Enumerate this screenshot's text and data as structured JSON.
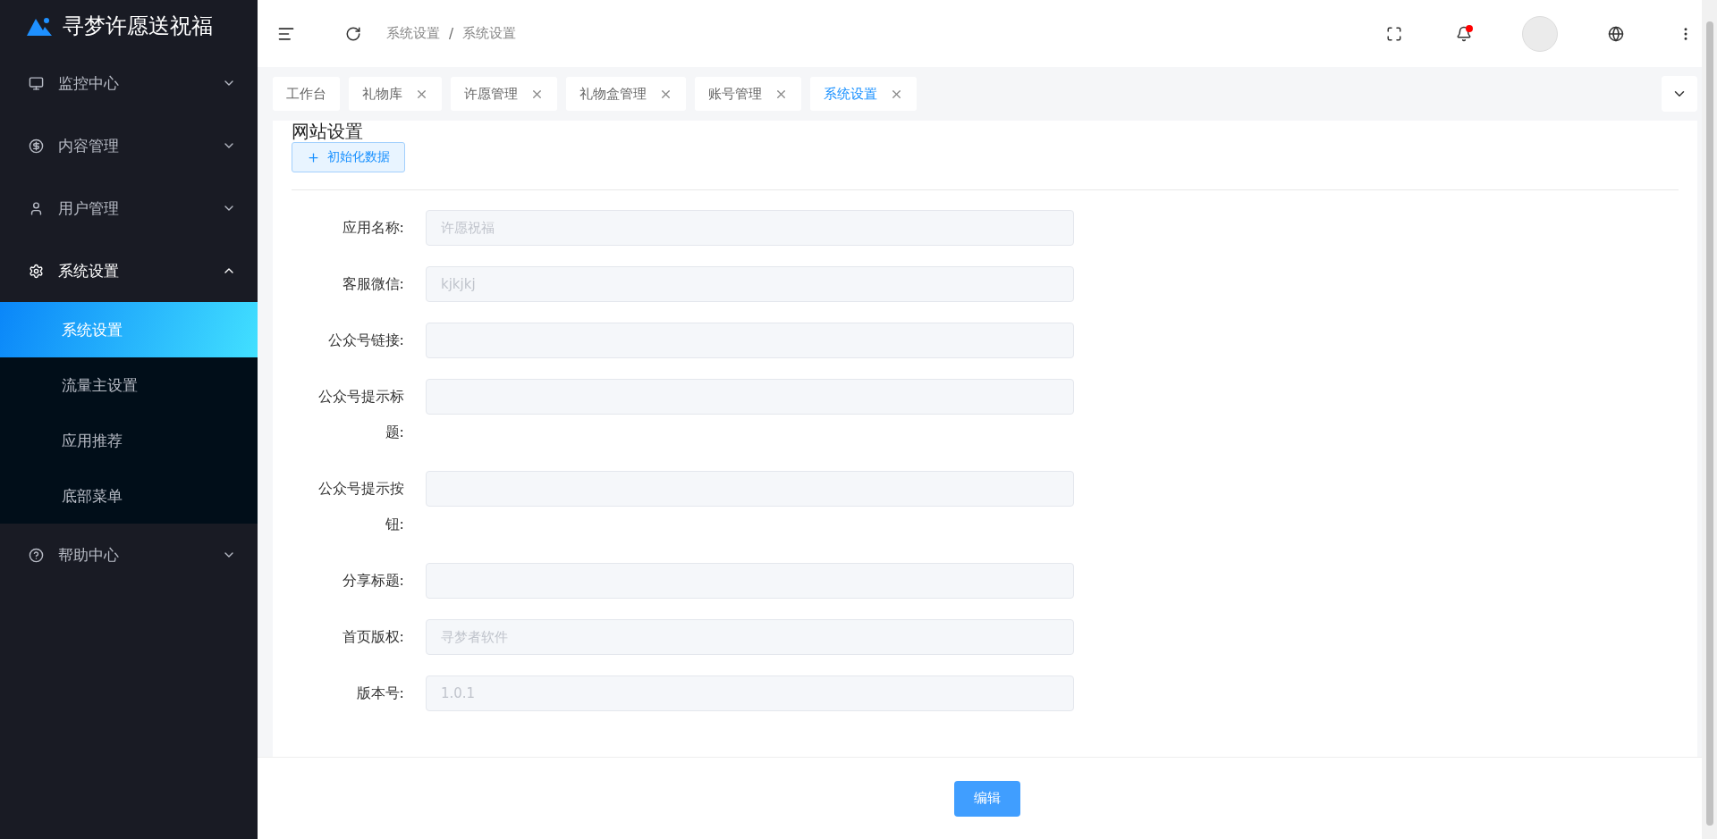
{
  "app": {
    "title": "寻梦许愿送祝福"
  },
  "sidebar": {
    "items": [
      {
        "label": "监控中心",
        "expanded": false
      },
      {
        "label": "内容管理",
        "expanded": false
      },
      {
        "label": "用户管理",
        "expanded": false
      },
      {
        "label": "系统设置",
        "expanded": true,
        "children": [
          {
            "label": "系统设置",
            "selected": true
          },
          {
            "label": "流量主设置",
            "selected": false
          },
          {
            "label": "应用推荐",
            "selected": false
          },
          {
            "label": "底部菜单",
            "selected": false
          }
        ]
      },
      {
        "label": "帮助中心",
        "expanded": false
      }
    ]
  },
  "header": {
    "breadcrumb": [
      "系统设置",
      "系统设置"
    ],
    "breadcrumb_separator": "/",
    "notifications_unread": true
  },
  "tabs": [
    {
      "label": "工作台",
      "closable": false,
      "selected": false
    },
    {
      "label": "礼物库",
      "closable": true,
      "selected": false
    },
    {
      "label": "许愿管理",
      "closable": true,
      "selected": false
    },
    {
      "label": "礼物盒管理",
      "closable": true,
      "selected": false
    },
    {
      "label": "账号管理",
      "closable": true,
      "selected": false
    },
    {
      "label": "系统设置",
      "closable": true,
      "selected": true
    }
  ],
  "panel": {
    "title": "网站设置",
    "init_button": "初始化数据",
    "fields": [
      {
        "label": "应用名称:",
        "value": "许愿祝福",
        "disabled": true
      },
      {
        "label": "客服微信:",
        "value": "kjkjkj",
        "disabled": true
      },
      {
        "label": "公众号链接:",
        "disabled": true
      },
      {
        "label": "公众号提示标题:",
        "disabled": true
      },
      {
        "label": "公众号提示按钮:",
        "disabled": true
      },
      {
        "label": "分享标题:",
        "disabled": true
      },
      {
        "label": "首页版权:",
        "value": "寻梦者软件",
        "disabled": true
      },
      {
        "label": "版本号:",
        "value": "1.0.1",
        "disabled": true
      }
    ]
  },
  "footer": {
    "edit_button": "编辑"
  }
}
